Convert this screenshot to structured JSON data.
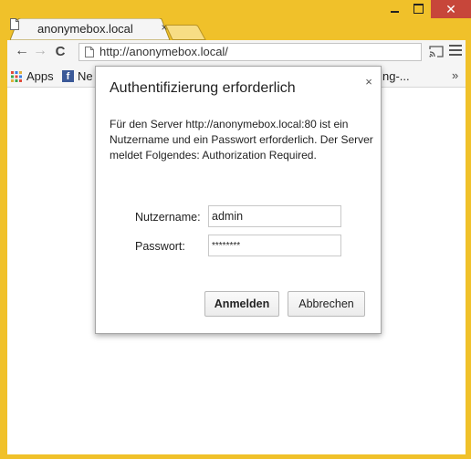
{
  "tab": {
    "title": "anonymebox.local",
    "close_glyph": "×",
    "icon": "page-icon"
  },
  "window_controls": {
    "close_glyph": "✕"
  },
  "toolbar": {
    "back_glyph": "←",
    "forward_glyph": "→",
    "reload_glyph": "C",
    "url": "http://anonymebox.local/"
  },
  "bookmarks": {
    "apps_label": "Apps",
    "facebook_glyph": "f",
    "facebook_label": "Ne",
    "truncated_label": "ng-...",
    "chevron": "»"
  },
  "dialog": {
    "title": "Authentifizierung erforderlich",
    "close_glyph": "×",
    "message": "Für den Server http://anonymebox.local:80 ist ein Nutzername und ein Passwort erforderlich. Der Server meldet Folgendes: Authorization Required.",
    "username_label": "Nutzername:",
    "username_value": "admin",
    "password_label": "Passwort:",
    "password_value": "********",
    "login_button": "Anmelden",
    "cancel_button": "Abbrechen"
  },
  "colors": {
    "frame": "#f0c12a",
    "close_button": "#c7463a",
    "facebook": "#3b5998"
  }
}
